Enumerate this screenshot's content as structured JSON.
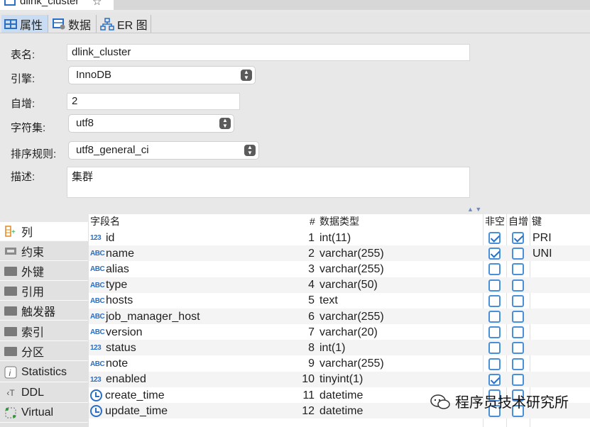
{
  "window": {
    "title": "dlink_cluster"
  },
  "tabs": [
    {
      "label": "属性",
      "icon": "table-icon"
    },
    {
      "label": "数据",
      "icon": "data-grid-icon"
    },
    {
      "label": "ER 图",
      "icon": "er-diagram-icon"
    }
  ],
  "properties": {
    "table_name_label": "表名:",
    "table_name": "dlink_cluster",
    "engine_label": "引擎:",
    "engine": "InnoDB",
    "auto_inc_label": "自增:",
    "auto_inc": "2",
    "charset_label": "字符集:",
    "charset": "utf8",
    "collation_label": "排序规则:",
    "collation": "utf8_general_ci",
    "description_label": "描述:",
    "description": "集群"
  },
  "sidebar": [
    {
      "label": "列",
      "icon": "columns-icon"
    },
    {
      "label": "约束",
      "icon": "constraint-icon"
    },
    {
      "label": "外键",
      "icon": "folder-icon"
    },
    {
      "label": "引用",
      "icon": "folder-icon"
    },
    {
      "label": "触发器",
      "icon": "folder-icon"
    },
    {
      "label": "索引",
      "icon": "folder-icon"
    },
    {
      "label": "分区",
      "icon": "folder-icon"
    },
    {
      "label": "Statistics",
      "icon": "info-icon"
    },
    {
      "label": "DDL",
      "icon": "ddl-icon"
    },
    {
      "label": "Virtual",
      "icon": "virtual-icon"
    }
  ],
  "columns_header": {
    "name": "字段名",
    "num": "#",
    "type": "数据类型",
    "not_null": "非空",
    "auto_inc": "自增",
    "key": "键"
  },
  "columns": [
    {
      "badge": "123",
      "name": "id",
      "num": "1",
      "type": "int(11)",
      "not_null": true,
      "auto_inc": true,
      "key": "PRI"
    },
    {
      "badge": "ABC",
      "name": "name",
      "num": "2",
      "type": "varchar(255)",
      "not_null": true,
      "auto_inc": false,
      "key": "UNI"
    },
    {
      "badge": "ABC",
      "name": "alias",
      "num": "3",
      "type": "varchar(255)",
      "not_null": false,
      "auto_inc": false,
      "key": ""
    },
    {
      "badge": "ABC",
      "name": "type",
      "num": "4",
      "type": "varchar(50)",
      "not_null": false,
      "auto_inc": false,
      "key": ""
    },
    {
      "badge": "ABC",
      "name": "hosts",
      "num": "5",
      "type": "text",
      "not_null": false,
      "auto_inc": false,
      "key": ""
    },
    {
      "badge": "ABC",
      "name": "job_manager_host",
      "num": "6",
      "type": "varchar(255)",
      "not_null": false,
      "auto_inc": false,
      "key": ""
    },
    {
      "badge": "ABC",
      "name": "version",
      "num": "7",
      "type": "varchar(20)",
      "not_null": false,
      "auto_inc": false,
      "key": ""
    },
    {
      "badge": "123",
      "name": "status",
      "num": "8",
      "type": "int(1)",
      "not_null": false,
      "auto_inc": false,
      "key": ""
    },
    {
      "badge": "ABC",
      "name": "note",
      "num": "9",
      "type": "varchar(255)",
      "not_null": false,
      "auto_inc": false,
      "key": ""
    },
    {
      "badge": "123",
      "name": "enabled",
      "num": "10",
      "type": "tinyint(1)",
      "not_null": true,
      "auto_inc": false,
      "key": ""
    },
    {
      "badge": "clock",
      "name": "create_time",
      "num": "11",
      "type": "datetime",
      "not_null": false,
      "auto_inc": false,
      "key": ""
    },
    {
      "badge": "clock",
      "name": "update_time",
      "num": "12",
      "type": "datetime",
      "not_null": false,
      "auto_inc": false,
      "key": ""
    }
  ],
  "watermark": "程序员技术研究所",
  "colors": {
    "accent": "#2a6fc7",
    "checkbox": "#4a90d9",
    "tab_active": "#c9dcf2"
  }
}
